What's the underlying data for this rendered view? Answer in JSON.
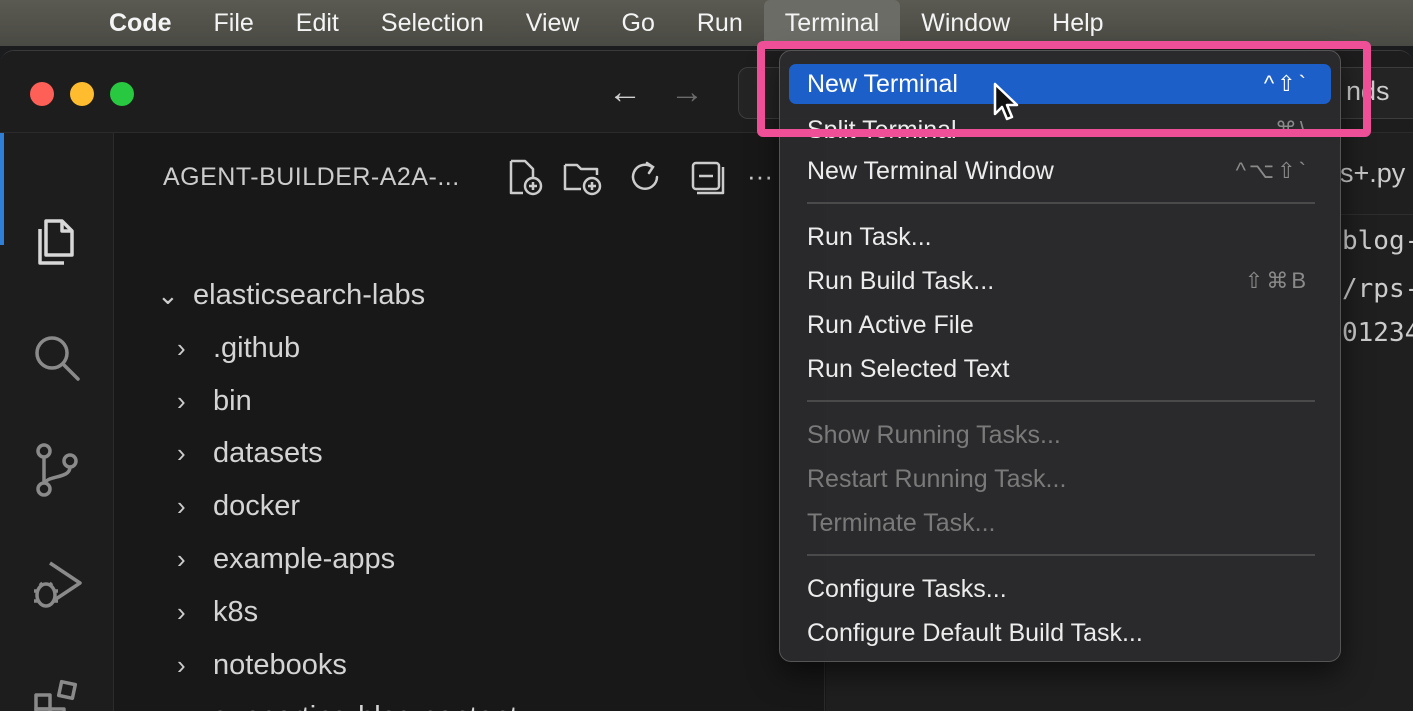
{
  "menubar": {
    "items": [
      "Code",
      "File",
      "Edit",
      "Selection",
      "View",
      "Go",
      "Run",
      "Terminal",
      "Window",
      "Help"
    ],
    "active": "Terminal"
  },
  "titlebar": {
    "back_icon": "arrow-left-icon",
    "forward_icon": "arrow-right-icon",
    "command_center_tail": "nds"
  },
  "activity_bar": {
    "icons": [
      "explorer-icon",
      "search-icon",
      "source-control-icon",
      "run-debug-icon",
      "extensions-icon"
    ]
  },
  "explorer": {
    "title": "AGENT-BUILDER-A2A-...",
    "tools": [
      "new-file-icon",
      "new-folder-icon",
      "refresh-icon",
      "collapse-all-icon"
    ],
    "more_label": "···",
    "tree": [
      {
        "label": "elasticsearch-labs",
        "expanded": true,
        "indent": 0
      },
      {
        "label": ".github",
        "expanded": false,
        "indent": 1
      },
      {
        "label": "bin",
        "expanded": false,
        "indent": 1
      },
      {
        "label": "datasets",
        "expanded": false,
        "indent": 1
      },
      {
        "label": "docker",
        "expanded": false,
        "indent": 1
      },
      {
        "label": "example-apps",
        "expanded": false,
        "indent": 1
      },
      {
        "label": "k8s",
        "expanded": false,
        "indent": 1
      },
      {
        "label": "notebooks",
        "expanded": false,
        "indent": 1
      },
      {
        "label": "supporting-blog-content",
        "expanded": true,
        "indent": 1
      }
    ]
  },
  "editor": {
    "tab_fragment": "s+.py",
    "code_fragments": [
      "blog-",
      "/rps-",
      "01234"
    ]
  },
  "terminal_menu": {
    "items": [
      {
        "label": "New Terminal",
        "shortcut": "^⇧`",
        "state": "highlight"
      },
      {
        "label": "Split Terminal",
        "shortcut": "⌘\\",
        "state": "clipped"
      },
      {
        "label": "New Terminal Window",
        "shortcut": "^⌥⇧`",
        "state": "normal"
      },
      {
        "label": "Run Task...",
        "shortcut": "",
        "state": "normal"
      },
      {
        "label": "Run Build Task...",
        "shortcut": "⇧⌘B",
        "state": "normal"
      },
      {
        "label": "Run Active File",
        "shortcut": "",
        "state": "normal"
      },
      {
        "label": "Run Selected Text",
        "shortcut": "",
        "state": "normal"
      },
      {
        "label": "Show Running Tasks...",
        "shortcut": "",
        "state": "disabled"
      },
      {
        "label": "Restart Running Task...",
        "shortcut": "",
        "state": "disabled"
      },
      {
        "label": "Terminate Task...",
        "shortcut": "",
        "state": "disabled"
      },
      {
        "label": "Configure Tasks...",
        "shortcut": "",
        "state": "normal"
      },
      {
        "label": "Configure Default Build Task...",
        "shortcut": "",
        "state": "normal"
      }
    ]
  },
  "colors": {
    "highlight": "#1c5fc9",
    "annotation": "#ee4f96",
    "activity_indicator": "#2f7fd8"
  }
}
